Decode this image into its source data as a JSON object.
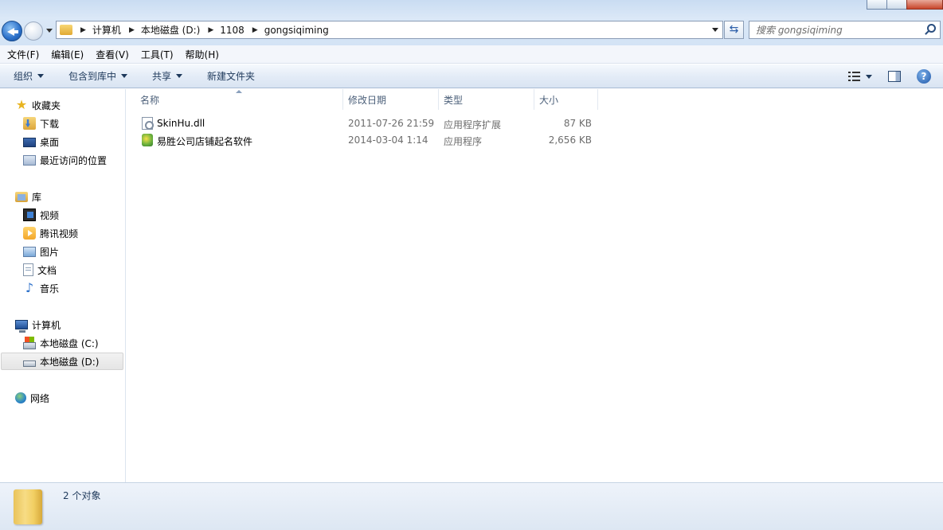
{
  "titlebar": {
    "tabs_faint": []
  },
  "address": {
    "crumbs": [
      "计算机",
      "本地磁盘 (D:)",
      "1108",
      "gongsiqiming"
    ]
  },
  "search": {
    "placeholder": "搜索 gongsiqiming"
  },
  "menu": {
    "items": [
      "文件(F)",
      "编辑(E)",
      "查看(V)",
      "工具(T)",
      "帮助(H)"
    ]
  },
  "toolbar": {
    "organize": "组织",
    "include_in_library": "包含到库中",
    "share": "共享",
    "new_folder": "新建文件夹"
  },
  "navpane": {
    "favorites": "收藏夹",
    "downloads": "下载",
    "desktop": "桌面",
    "recent": "最近访问的位置",
    "libraries": "库",
    "videos": "视频",
    "tencent_video": "腾讯视频",
    "pictures": "图片",
    "documents": "文档",
    "music": "音乐",
    "computer": "计算机",
    "drive_c": "本地磁盘 (C:)",
    "drive_d": "本地磁盘 (D:)",
    "network": "网络"
  },
  "columns": {
    "name": "名称",
    "date": "修改日期",
    "type": "类型",
    "size": "大小"
  },
  "files": [
    {
      "name": "SkinHu.dll",
      "date": "2011-07-26 21:59",
      "type": "应用程序扩展",
      "size": "87 KB",
      "icon": "dll-file-icon"
    },
    {
      "name": "易胜公司店铺起名软件",
      "date": "2014-03-04 1:14",
      "type": "应用程序",
      "size": "2,656 KB",
      "icon": "exe-app-icon"
    }
  ],
  "status": {
    "count": "2 个对象"
  }
}
